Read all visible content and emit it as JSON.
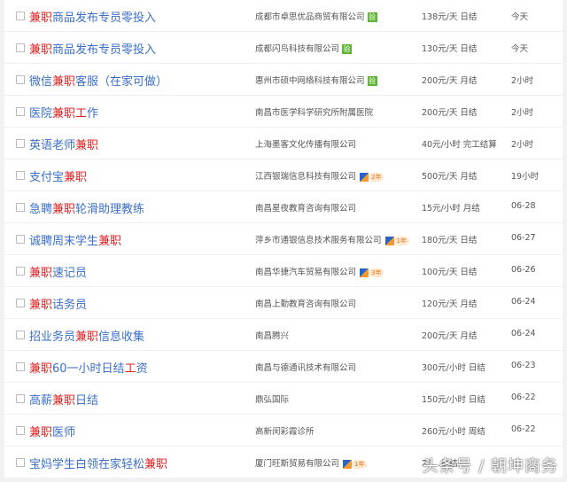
{
  "rows": [
    {
      "title": [
        {
          "t": "兼职",
          "hl": true
        },
        {
          "t": "商品发布专员零投入"
        }
      ],
      "company": "成都市卓思优品商贸有限公司",
      "badge": "v",
      "badge_text": "验",
      "salary": "138元/天 日结",
      "time": "今天"
    },
    {
      "title": [
        {
          "t": "兼职",
          "hl": true
        },
        {
          "t": "商品发布专员零投入"
        }
      ],
      "company": "成都闪鸟科技有限公司",
      "badge": "v",
      "badge_text": "验",
      "salary": "130元/天 日结",
      "time": "今天"
    },
    {
      "title": [
        {
          "t": "微信"
        },
        {
          "t": "兼职",
          "hl": true
        },
        {
          "t": "客服（在家可做）"
        }
      ],
      "company": "惠州市硕中网络科技有限公司",
      "badge": "v",
      "badge_text": "验",
      "salary": "200元/天 月结",
      "time": "2小时"
    },
    {
      "title": [
        {
          "t": "医院"
        },
        {
          "t": "兼职",
          "hl": true
        },
        {
          "t": "工",
          "hl": true
        },
        {
          "t": "作"
        }
      ],
      "company": "南昌市医学科学研究所附属医院",
      "badge": "",
      "salary": "200元/天 日结",
      "time": "2小时"
    },
    {
      "title": [
        {
          "t": "英语老师"
        },
        {
          "t": "兼职",
          "hl": true
        }
      ],
      "company": "上海墨客文化传播有限公司",
      "badge": "",
      "salary": "40元/小时 完工结算",
      "time": "2小时"
    },
    {
      "title": [
        {
          "t": "支付宝"
        },
        {
          "t": "兼职",
          "hl": true
        }
      ],
      "company": "江西银瑞信息科技有限公司",
      "badge": "y",
      "badge_text": "2年",
      "salary": "500元/天 月结",
      "time": "19小时"
    },
    {
      "title": [
        {
          "t": "急聘"
        },
        {
          "t": "兼职",
          "hl": true
        },
        {
          "t": "轮滑助理教练"
        }
      ],
      "company": "南昌星夜教育咨询有限公司",
      "badge": "",
      "salary": "15元/小时 月结",
      "time": "06-28"
    },
    {
      "title": [
        {
          "t": "诚聘周末学生"
        },
        {
          "t": "兼职",
          "hl": true
        }
      ],
      "company": "萍乡市通银信息技术服务有限公司",
      "badge": "y",
      "badge_text": "1年",
      "salary": "180元/天 日结",
      "time": "06-27"
    },
    {
      "title": [
        {
          "t": "兼职",
          "hl": true
        },
        {
          "t": "速记员"
        }
      ],
      "company": "南昌华捷汽车贸易有限公司",
      "badge": "y",
      "badge_text": "3年",
      "salary": "100元/天 日结",
      "time": "06-26"
    },
    {
      "title": [
        {
          "t": "兼职",
          "hl": true
        },
        {
          "t": "话务员"
        }
      ],
      "company": "南昌上勤教育咨询有限公司",
      "badge": "",
      "salary": "120元/天 月结",
      "time": "06-24"
    },
    {
      "title": [
        {
          "t": "招业务员"
        },
        {
          "t": "兼职",
          "hl": true
        },
        {
          "t": "信息收集"
        }
      ],
      "company": "南昌腾兴",
      "badge": "",
      "salary": "200元/天 月结",
      "time": "06-24"
    },
    {
      "title": [
        {
          "t": "兼职",
          "hl": true
        },
        {
          "t": "60一小时日结"
        },
        {
          "t": "工",
          "hl": true
        },
        {
          "t": "资"
        }
      ],
      "company": "南昌与德通讯技术有限公司",
      "badge": "",
      "salary": "300元/小时 日结",
      "time": "06-23"
    },
    {
      "title": [
        {
          "t": "高薪"
        },
        {
          "t": "兼职",
          "hl": true
        },
        {
          "t": "日结"
        }
      ],
      "company": "鼎弘国际",
      "badge": "",
      "salary": "150元/小时 日结",
      "time": "06-22"
    },
    {
      "title": [
        {
          "t": "兼职",
          "hl": true
        },
        {
          "t": "医师"
        }
      ],
      "company": "高新闵彩霞诊所",
      "badge": "",
      "salary": "260元/小时 周结",
      "time": "06-22"
    },
    {
      "title": [
        {
          "t": "宝妈学生白领在家轻松"
        },
        {
          "t": "兼职",
          "hl": true
        }
      ],
      "company": "厦门旺斯贸易有限公司",
      "badge": "y",
      "badge_text": "1年",
      "salary": "23…日结",
      "time": ""
    }
  ],
  "watermark": "头条号 / 朝坤商务",
  "colors": {
    "link": "#3a6fc9",
    "highlight": "#e02020",
    "verified": "#5cb531"
  }
}
